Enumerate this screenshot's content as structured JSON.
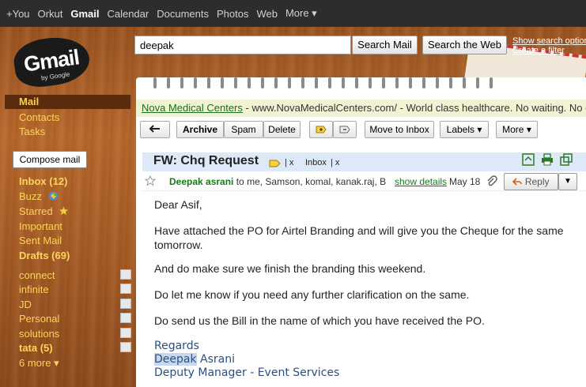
{
  "topnav": {
    "items": [
      "+You",
      "Orkut",
      "Gmail",
      "Calendar",
      "Documents",
      "Photos",
      "Web",
      "More ▾"
    ],
    "active_index": 2
  },
  "logo": {
    "text": "Gmail",
    "sub": "by Google"
  },
  "search": {
    "query": "deepak",
    "search_mail_label": "Search Mail",
    "search_web_label": "Search the Web",
    "show_options": "Show search options",
    "create_filter": "Create a filter"
  },
  "sidebar": {
    "mail_label": "Mail",
    "contacts_label": "Contacts",
    "tasks_label": "Tasks",
    "compose_label": "Compose mail",
    "inbox_label": "Inbox (12)",
    "buzz_label": "Buzz",
    "starred_label": "Starred",
    "important_label": "Important",
    "sent_label": "Sent Mail",
    "drafts_label": "Drafts (69)",
    "labels": [
      {
        "name": "connect",
        "bold": false
      },
      {
        "name": "infinite",
        "bold": false
      },
      {
        "name": "JD",
        "bold": false
      },
      {
        "name": "Personal",
        "bold": false
      },
      {
        "name": "solutions",
        "bold": false
      },
      {
        "name": "tata (5)",
        "bold": true
      }
    ],
    "more_label": "6 more ▾"
  },
  "ad": {
    "link": "Nova Medical Centers",
    "text": " - www.NovaMedicalCenters.com/ - World class healthcare. No waiting. No extra c"
  },
  "toolbar": {
    "back_icon": "back-arrow-icon",
    "archive_label": "Archive",
    "spam_label": "Spam",
    "delete_label": "Delete",
    "move_to_inbox_label": "Move to Inbox",
    "labels_label": "Labels ▾",
    "more_label": "More ▾"
  },
  "message": {
    "subject": "FW: Chq Request",
    "tag_x1": "| x",
    "inbox_tag": "Inbox",
    "tag_x2": "| x",
    "sender": "Deepak asrani",
    "recipients": " to me, Samson, komal, kanak.raj, B",
    "show_details": "show details",
    "date": "May 18",
    "reply_label": "Reply",
    "body": [
      "Dear Asif,",
      "Have attached the PO for Airtel Branding and will give you the Cheque for the same",
      "tomorrow.",
      "And do make sure we finish the branding this weekend.",
      "Do let me know if you need any further clarification on the same.",
      "Do send us the Bill in the name of which you have received the PO."
    ],
    "sig_regards": "Regards",
    "sig_name_first": "Deepak",
    "sig_name_last": " Asrani",
    "sig_title": "Deputy Manager - Event Services"
  },
  "colors": {
    "accent_yellow": "#ffd45a",
    "topbar": "#2d2d2d",
    "subject_bar": "#dde9f7"
  }
}
